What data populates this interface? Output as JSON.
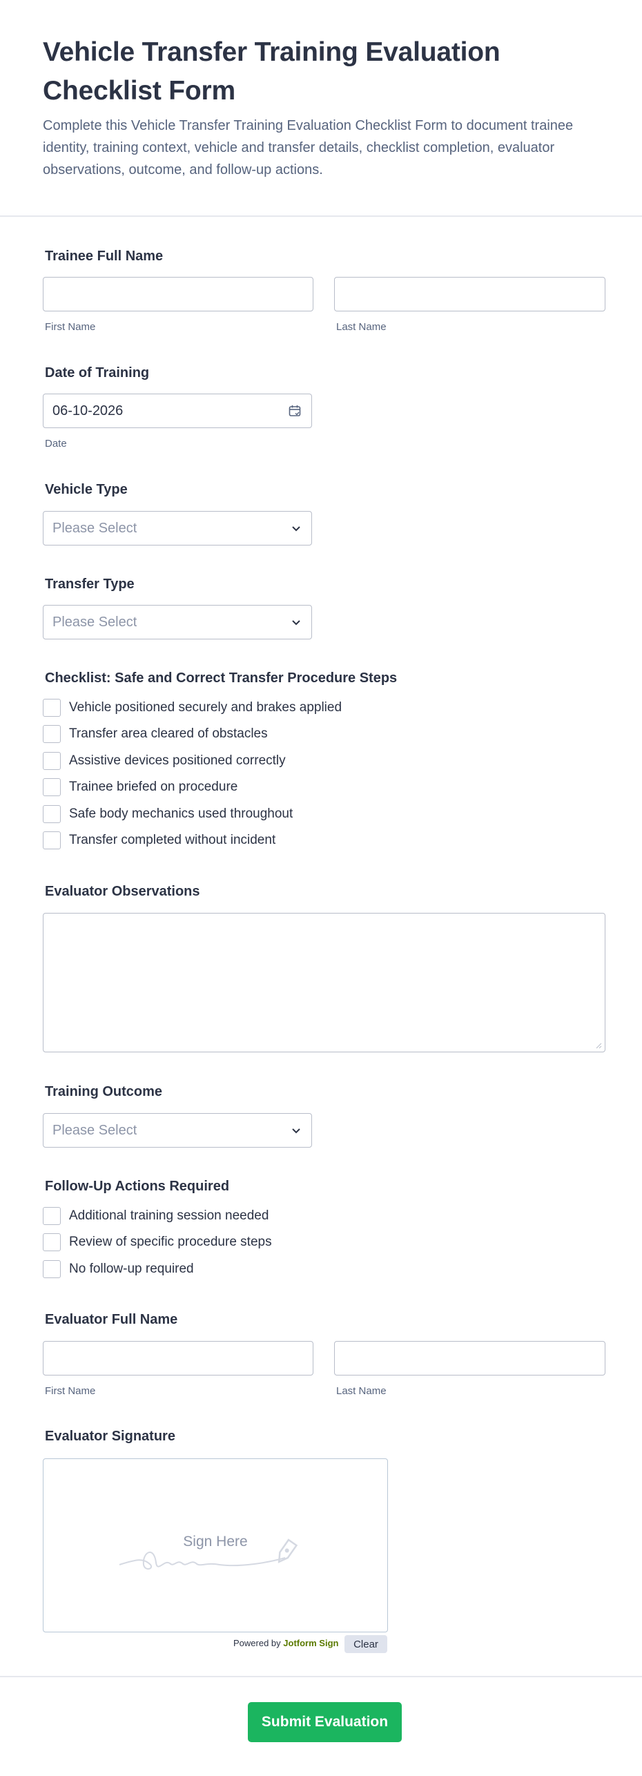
{
  "header": {
    "title": "Vehicle Transfer Training Evaluation Checklist Form",
    "description": "Complete this Vehicle Transfer Training Evaluation Checklist Form to document trainee identity, training context, vehicle and transfer details, checklist completion, evaluator observations, outcome, and follow-up actions."
  },
  "trainee_name": {
    "label": "Trainee Full Name",
    "first_sublabel": "First Name",
    "last_sublabel": "Last Name",
    "first_value": "",
    "last_value": ""
  },
  "date_of_training": {
    "label": "Date of Training",
    "value": "06-10-2026",
    "sublabel": "Date",
    "icon": "calendar-icon"
  },
  "vehicle_type": {
    "label": "Vehicle Type",
    "placeholder": "Please Select"
  },
  "transfer_type": {
    "label": "Transfer Type",
    "placeholder": "Please Select"
  },
  "checklist": {
    "label": "Checklist: Safe and Correct Transfer Procedure Steps",
    "items": [
      "Vehicle positioned securely and brakes applied",
      "Transfer area cleared of obstacles",
      "Assistive devices positioned correctly",
      "Trainee briefed on procedure",
      "Safe body mechanics used throughout",
      "Transfer completed without incident"
    ]
  },
  "observations": {
    "label": "Evaluator Observations",
    "value": ""
  },
  "training_outcome": {
    "label": "Training Outcome",
    "placeholder": "Please Select"
  },
  "follow_up": {
    "label": "Follow-Up Actions Required",
    "items": [
      "Additional training session needed",
      "Review of specific procedure steps",
      "No follow-up required"
    ]
  },
  "evaluator_name": {
    "label": "Evaluator Full Name",
    "first_sublabel": "First Name",
    "last_sublabel": "Last Name"
  },
  "signature": {
    "label": "Evaluator Signature",
    "placeholder": "Sign Here",
    "powered_prefix": "Powered by",
    "powered_brand": "Jotform Sign",
    "clear_label": "Clear"
  },
  "submit_label": "Submit Evaluation",
  "colors": {
    "submit": "#1bb55f",
    "text": "#2c3345",
    "subtext": "#57647e",
    "border": "#b8bdc9"
  }
}
